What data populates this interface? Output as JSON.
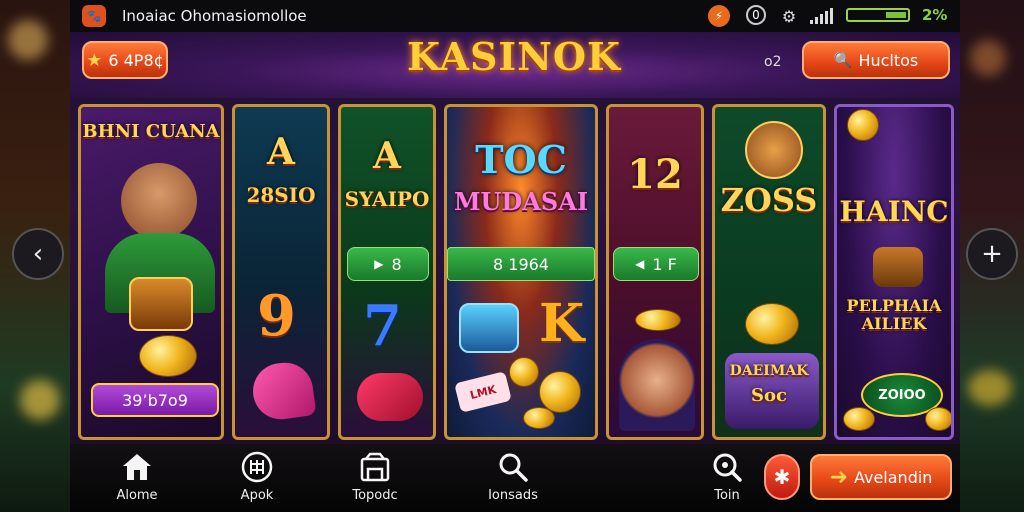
{
  "status_bar": {
    "app_title": "Inoaiac Ohomasiomolloe",
    "battery_text": "2%",
    "indicator_labels": [
      "0",
      "⚙"
    ]
  },
  "header": {
    "promo_button": "6 4P8¢",
    "logo_text": "KASINOK",
    "count": "o2",
    "search_button": "Hucltos"
  },
  "games": [
    {
      "title": "BHNI CUANA",
      "cta": "39’b7o9"
    },
    {
      "title": "A",
      "subtitle": "28SIO"
    },
    {
      "title": "A",
      "subtitle": "SYAIPO",
      "chip": "8"
    },
    {
      "title": "TOC",
      "subtitle": "MUDASAI",
      "chip": "8 1964"
    },
    {
      "title": "12",
      "chip": "1 F"
    },
    {
      "title": "ZOSS"
    },
    {
      "title": "HAINC",
      "subtitle": "PELPHAIA AILIEK",
      "extra": "ZOIOO"
    }
  ],
  "card_texts": {
    "nine": "9",
    "seven": "7",
    "k": "K",
    "card5_lower": "DAEIMAK",
    "card5_sub": "Soc",
    "token": "LMK"
  },
  "nav": {
    "items": [
      {
        "label": "Alome",
        "icon": "home-icon"
      },
      {
        "label": "Apok",
        "icon": "grid-icon"
      },
      {
        "label": "Topodc",
        "icon": "store-icon"
      },
      {
        "label": "Ionsads",
        "icon": "search-icon"
      },
      {
        "label": "Toin",
        "icon": "zoom-icon"
      }
    ],
    "cta_label": "Avelandin"
  },
  "colors": {
    "accent_orange": "#e44616",
    "gold": "#ffcf3a",
    "green_chip": "#2fa23a",
    "purple": "#3a1658"
  }
}
